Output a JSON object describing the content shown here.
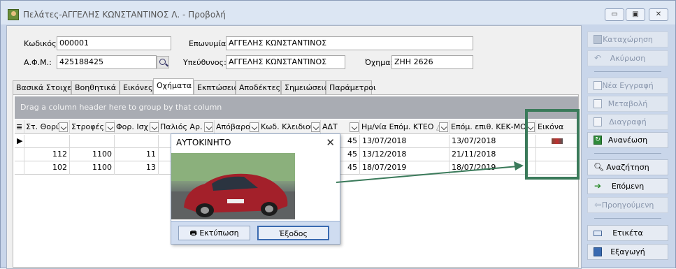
{
  "window": {
    "title": "Πελάτες-ΑΓΓΕΛΗΣ ΚΩΝΣΤΑΝΤΙΝΟΣ Λ. - Προβολή"
  },
  "form": {
    "code_label": "Κωδικός:",
    "code_value": "000001",
    "afm_label": "Α.Φ.Μ.:",
    "afm_value": "425188425",
    "name_label": "Επωνυμία:",
    "name_value": "ΑΓΓΕΛΗΣ ΚΩΝΣΤΑΝΤΙΝΟΣ",
    "resp_label": "Υπεύθυνος:",
    "resp_value": "ΑΓΓΕΛΗΣ ΚΩΝΣΤΑΝΤΙΝΟΣ",
    "vehicle_label": "Όχημα:",
    "vehicle_value": "ΖΗΗ 2626"
  },
  "tabs": [
    "Βασικά Στοιχεία",
    "Βοηθητικά",
    "Εικόνες",
    "Οχήματα",
    "Εκπτώσεις",
    "Αποδέκτες",
    "Σημειώσεις",
    "Παράμετροι"
  ],
  "active_tab": "Οχήματα",
  "grid": {
    "group_hint": "Drag a column header here to group by that column",
    "columns": [
      "Στ. Θορύ",
      "Στροφές",
      "Φορ. Ισχ",
      "Παλιός Αρ.",
      "Απόβαρο",
      "Κωδ. Κλειδιού",
      "ΑΔΤ",
      "Ημ/νία Επόμ. ΚΤΕΟ",
      "Επόμ. επιθ. ΚΕΚ-ΜΟΤ",
      "Εικόνα"
    ],
    "rows": [
      [
        "",
        "",
        "",
        "",
        "",
        "",
        "45",
        "13/07/2018",
        "13/07/2018",
        "img"
      ],
      [
        "112",
        "1100",
        "11",
        "",
        "",
        "",
        "45",
        "13/12/2018",
        "21/11/2018",
        ""
      ],
      [
        "102",
        "1100",
        "13",
        "",
        "",
        "",
        "45",
        "18/07/2019",
        "18/07/2019",
        ""
      ]
    ]
  },
  "sidebar": {
    "save": "Καταχώρηση",
    "cancel": "Ακύρωση",
    "new": "Νέα Εγγραφή",
    "edit": "Μεταβολή",
    "delete": "Διαγραφή",
    "refresh": "Ανανέωση",
    "search": "Αναζήτηση",
    "next": "Επόμενη",
    "prev": "Προηγούμενη",
    "label": "Ετικέτα",
    "export": "Εξαγωγή"
  },
  "dialog": {
    "title": "ΑΥΤΟΚΙΝΗΤΟ",
    "print": "Εκτύπωση",
    "exit": "Έξοδος"
  },
  "colors": {
    "highlight": "#3a7a5a",
    "car": "#a3202a"
  }
}
